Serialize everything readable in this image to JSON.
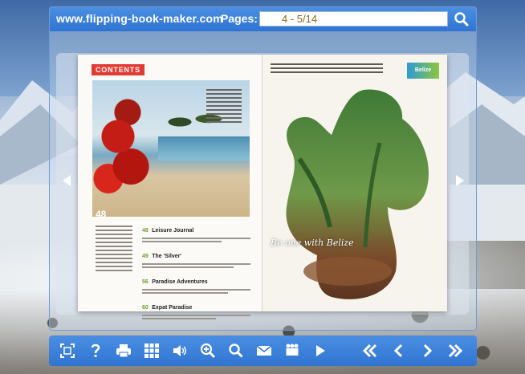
{
  "header": {
    "site_url": "www.flipping-book-maker.com",
    "pages_label": "Pages:",
    "pages_value": "4 - 5/14"
  },
  "book": {
    "left_page": {
      "contents_label": "CONTENTS",
      "photo_number": "48",
      "toc": [
        {
          "num": "48",
          "title": "Leisure Journal"
        },
        {
          "num": "49",
          "title": "The 'Silver'"
        },
        {
          "num": "56",
          "title": "Paradise Adventures"
        },
        {
          "num": "60",
          "title": "Expat Paradise"
        }
      ]
    },
    "right_page": {
      "logo_text": "Belize",
      "tagline": "Be one with Belize"
    }
  },
  "toolbar": {
    "buttons": [
      "fullscreen-icon",
      "help-icon",
      "print-icon",
      "thumbnails-icon",
      "sound-icon",
      "zoom-in-icon",
      "search-icon",
      "email-icon",
      "share-icon",
      "autoplay-icon",
      "first-page-icon",
      "previous-page-icon",
      "next-page-icon",
      "last-page-icon"
    ]
  },
  "colors": {
    "bar_blue": "#3a80dc",
    "contents_red": "#e23b34",
    "toc_green": "#6ea02f",
    "page_value": "#8b6a16"
  }
}
